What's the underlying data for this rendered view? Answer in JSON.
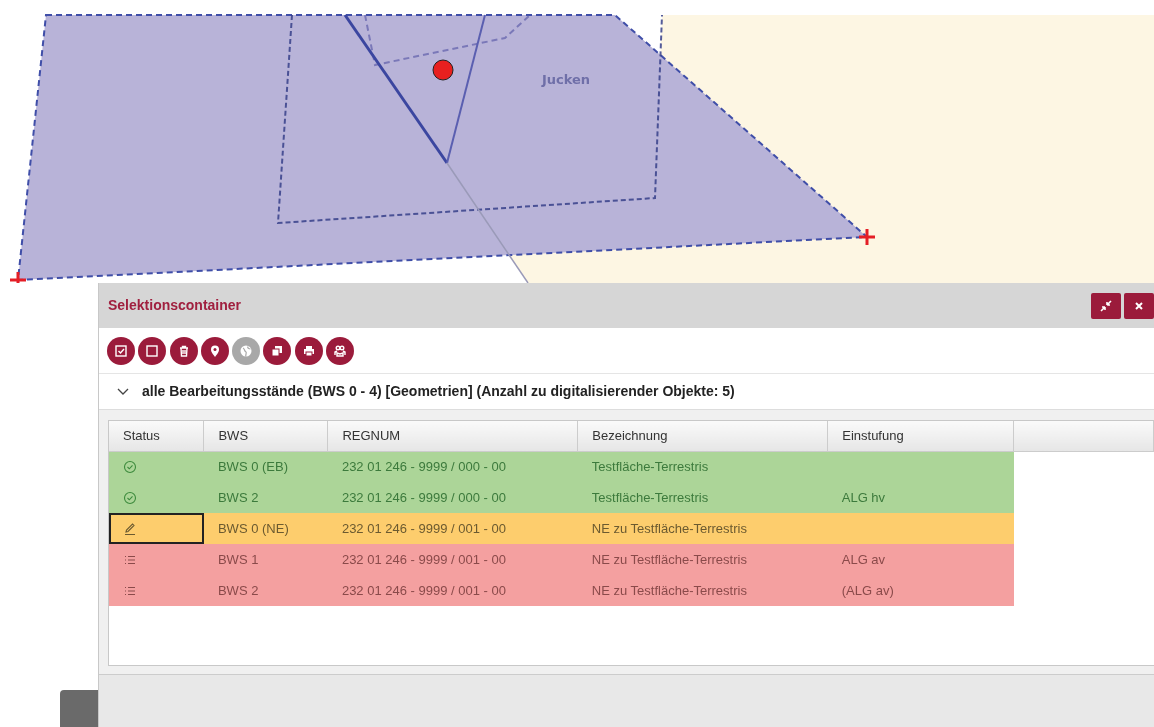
{
  "map": {
    "label": "Jucken"
  },
  "panel": {
    "title": "Selektionscontainer",
    "toolbar": [
      {
        "kind": "check",
        "disabled": false
      },
      {
        "kind": "square",
        "disabled": false
      },
      {
        "kind": "trash",
        "disabled": false
      },
      {
        "kind": "pin",
        "disabled": false
      },
      {
        "kind": "globe",
        "disabled": true
      },
      {
        "kind": "copy",
        "disabled": false
      },
      {
        "kind": "print",
        "disabled": false
      },
      {
        "kind": "people",
        "disabled": false
      }
    ],
    "group": {
      "expanded": true,
      "title": "alle Bearbeitungsstände (BWS 0 - 4) [Geometrien] (Anzahl zu digitalisierender Objekte: 5)"
    },
    "table": {
      "columns": [
        "Status",
        "BWS",
        "REGNUM",
        "Bezeichnung",
        "Einstufung"
      ],
      "rows": [
        {
          "kind": "done",
          "selected": false,
          "bws": "BWS 0 (EB)",
          "regnum": "232 01 246 - 9999 / 000 - 00",
          "bezeichnung": "Testfläche-Terrestris"
        },
        {
          "kind": "done",
          "selected": false,
          "bws": "BWS 2",
          "regnum": "232 01 246 - 9999 / 000 - 00",
          "bezeichnung": "Testfläche-Terrestris",
          "einstufung": "ALG hv"
        },
        {
          "kind": "edit",
          "selected": true,
          "bws": "BWS 0 (NE)",
          "regnum": "232 01 246 - 9999 / 001 - 00",
          "bezeichnung": "NE zu Testfläche-Terrestris"
        },
        {
          "kind": "open",
          "selected": false,
          "bws": "BWS 1",
          "regnum": "232 01 246 - 9999 / 001 - 00",
          "bezeichnung": "NE zu Testfläche-Terrestris",
          "einstufung": "ALG av"
        },
        {
          "kind": "open",
          "selected": false,
          "bws": "BWS 2",
          "regnum": "232 01 246 - 9999 / 001 - 00",
          "bezeichnung": "NE zu Testfläche-Terrestris",
          "einstufung": "(ALG av)"
        }
      ]
    }
  }
}
